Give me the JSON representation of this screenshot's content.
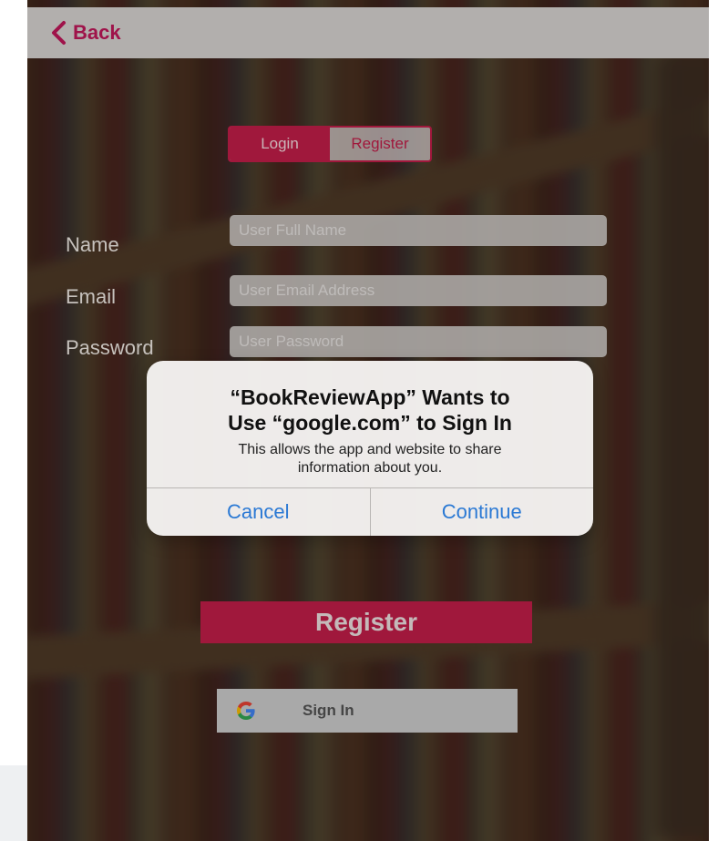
{
  "navbar": {
    "back_label": "Back"
  },
  "segmented": {
    "login_label": "Login",
    "register_label": "Register",
    "selected": "Login"
  },
  "form": {
    "name_label": "Name",
    "name_placeholder": "User Full Name",
    "email_label": "Email",
    "email_placeholder": "User Email Address",
    "password_label": "Password",
    "password_placeholder": "User Password"
  },
  "alert": {
    "title_line1": "“BookReviewApp” Wants to",
    "title_line2": "Use “google.com” to Sign In",
    "message": "This allows the app and website to share information about you.",
    "cancel_label": "Cancel",
    "continue_label": "Continue"
  },
  "actions": {
    "register_label": "Register",
    "google_signin_label": "Sign In"
  },
  "colors": {
    "accent": "#c41e4a",
    "link_blue": "#2b79d4"
  }
}
